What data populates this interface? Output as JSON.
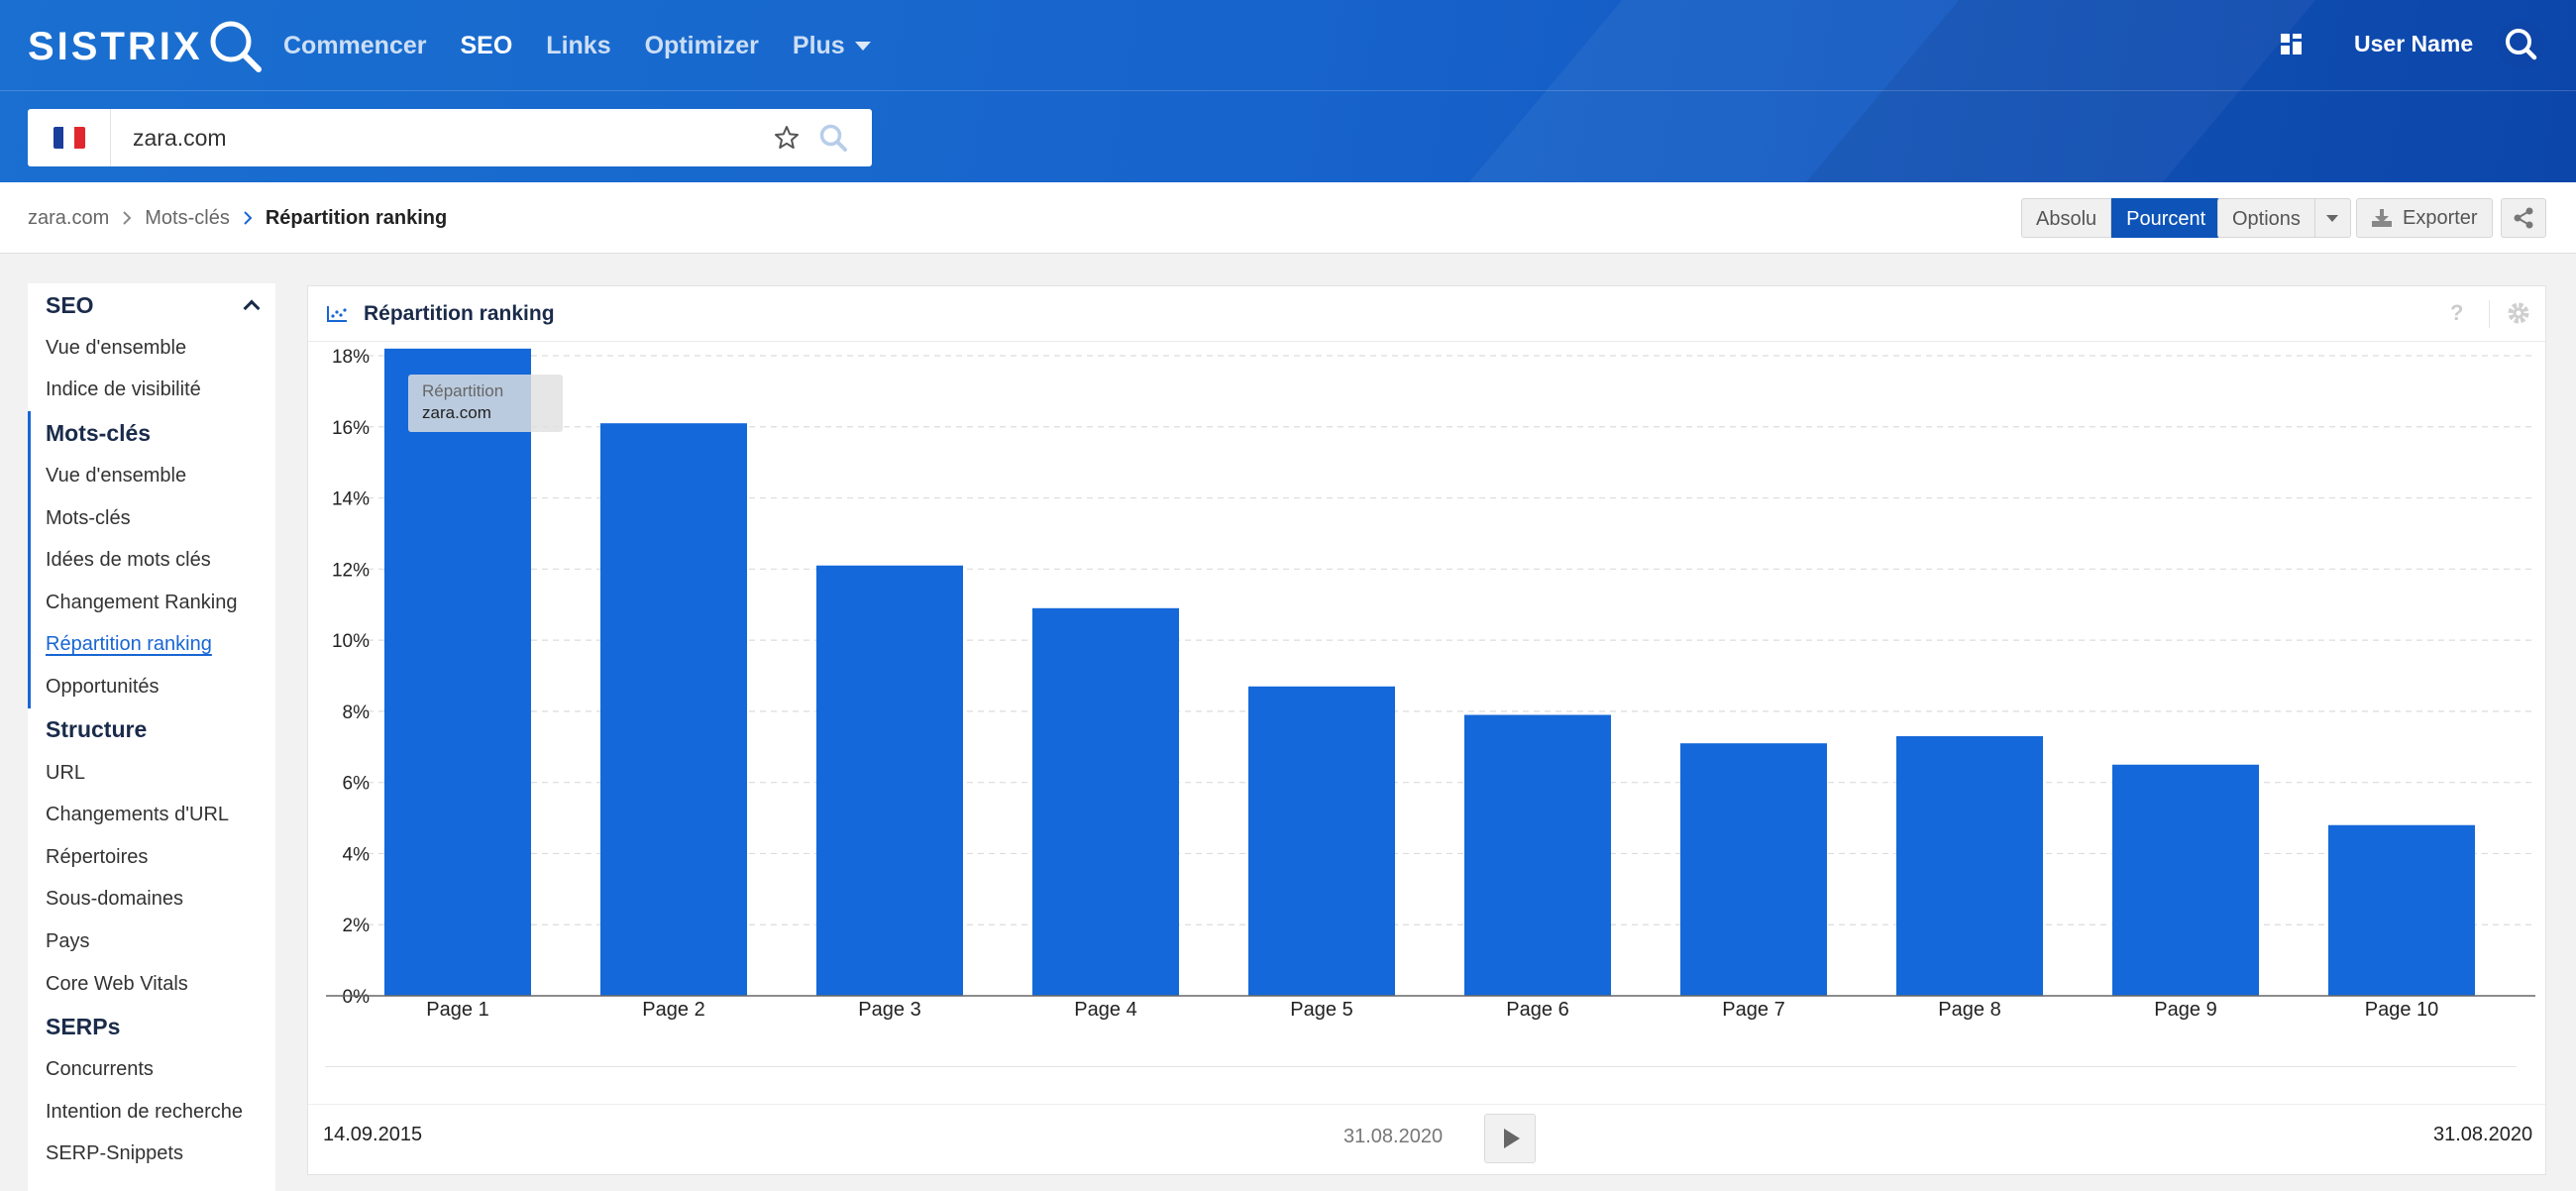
{
  "app": {
    "logo": "SISTRIX",
    "nav": [
      {
        "label": "Commencer",
        "active": false
      },
      {
        "label": "SEO",
        "active": true
      },
      {
        "label": "Links",
        "active": false
      },
      {
        "label": "Optimizer",
        "active": false
      },
      {
        "label": "Plus",
        "active": false
      }
    ],
    "username": "User Name"
  },
  "search": {
    "value": "zara.com",
    "country_flag": [
      "#1b3d9c",
      "#ffffff",
      "#e1272d"
    ]
  },
  "breadcrumb": {
    "items": [
      "zara.com",
      "Mots-clés",
      "Répartition ranking"
    ]
  },
  "toolbar": {
    "absolu_label": "Absolu",
    "pourcent_label": "Pourcent",
    "options_label": "Options",
    "export_label": "Exporter"
  },
  "sidebar": {
    "sections": [
      {
        "title": "SEO",
        "collapsible": true,
        "items": [
          "Vue d'ensemble",
          "Indice de visibilité"
        ]
      },
      {
        "title": "Mots-clés",
        "items": [
          "Vue d'ensemble",
          "Mots-clés",
          "Idées de mots clés",
          "Changement Ranking",
          "Répartition ranking",
          "Opportunités"
        ],
        "active_item": "Répartition ranking"
      },
      {
        "title": "Structure",
        "items": [
          "URL",
          "Changements d'URL",
          "Répertoires",
          "Sous-domaines",
          "Pays",
          "Core Web Vitals"
        ]
      },
      {
        "title": "SERPs",
        "items": [
          "Concurrents",
          "Intention de recherche",
          "SERP-Snippets"
        ]
      }
    ]
  },
  "panel": {
    "title": "Répartition ranking",
    "help": "?"
  },
  "tooltip": {
    "label": "Répartition",
    "value": "zara.com"
  },
  "timeline": {
    "start": "14.09.2015",
    "current": "31.08.2020",
    "end": "31.08.2020"
  },
  "colors": {
    "accent": "#1866d4",
    "bar": "#1468d9",
    "header": "#1764cc"
  },
  "chart_data": {
    "type": "bar",
    "categories": [
      "Page 1",
      "Page 2",
      "Page 3",
      "Page 4",
      "Page 5",
      "Page 6",
      "Page 7",
      "Page 8",
      "Page 9",
      "Page 10"
    ],
    "series": [
      {
        "name": "zara.com",
        "values": [
          18.2,
          16.1,
          12.1,
          10.9,
          8.7,
          7.9,
          7.1,
          7.3,
          6.5,
          4.8
        ]
      }
    ],
    "yticks": [
      "0%",
      "2%",
      "4%",
      "6%",
      "8%",
      "10%",
      "12%",
      "14%",
      "16%",
      "18%"
    ],
    "ylim": [
      0,
      18
    ],
    "grid": true,
    "legend": "none"
  }
}
